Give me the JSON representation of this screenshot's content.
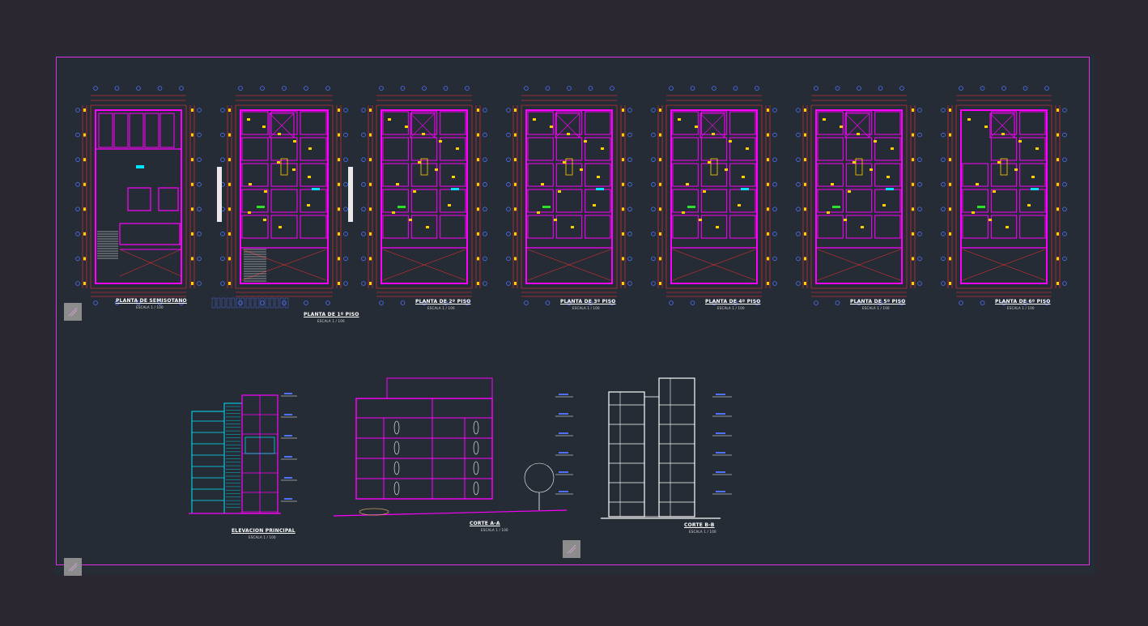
{
  "drawing": {
    "colors": {
      "background": "#2b2730",
      "sheet": "#252c35",
      "frame": "#e02fe0",
      "walls": "#ff00ff",
      "dimension_lines": "#ff3030",
      "axis_bubbles": "#4f73ff",
      "fixtures": "#ffd000",
      "accent": "#00e5ff",
      "elevation_lines": "#ffffff",
      "green": "#2ee02e"
    },
    "plans": [
      {
        "title": "PLANTA DE SEMISOTANO",
        "scale": "ESCALA 1 / 100"
      },
      {
        "title": "PLANTA DE 1º PISO",
        "scale": "ESCALA 1 / 100"
      },
      {
        "title": "PLANTA DE 2º PISO",
        "scale": "ESCALA 1 / 100"
      },
      {
        "title": "PLANTA DE 3º PISO",
        "scale": "ESCALA 1 / 100"
      },
      {
        "title": "PLANTA DE 4º PISO",
        "scale": "ESCALA 1 / 100"
      },
      {
        "title": "PLANTA DE 5º PISO",
        "scale": "ESCALA 1 / 100"
      },
      {
        "title": "PLANTA DE 6º PISO",
        "scale": "ESCALA 1 / 100"
      }
    ],
    "elevation": {
      "title": "ELEVACION PRINCIPAL",
      "scale": "ESCALA 1 / 100"
    },
    "section_a": {
      "title": "CORTE A-A",
      "scale": "ESCALA 1 / 100"
    },
    "section_b": {
      "title": "CORTE B-B",
      "scale": "ESCALA 1 / 100"
    },
    "icons": [
      "north-arrow-icon",
      "title-block-icon"
    ]
  }
}
